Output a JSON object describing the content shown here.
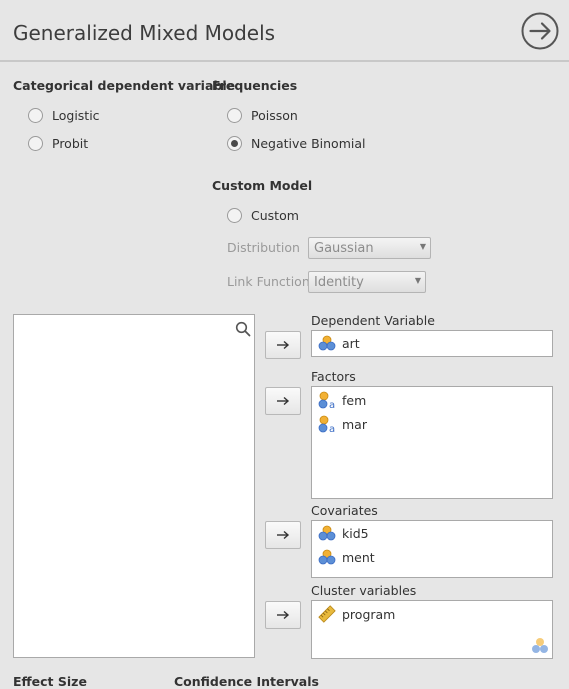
{
  "header": {
    "title": "Generalized Mixed Models",
    "go_icon": "arrow-circle-right-icon"
  },
  "categorical": {
    "title": "Categorical dependent variable",
    "options": [
      {
        "label": "Logistic",
        "selected": false
      },
      {
        "label": "Probit",
        "selected": false
      }
    ]
  },
  "frequencies": {
    "title": "Frequencies",
    "options": [
      {
        "label": "Poisson",
        "selected": false
      },
      {
        "label": "Negative Binomial",
        "selected": true
      }
    ]
  },
  "custom_model": {
    "title": "Custom Model",
    "custom_label": "Custom",
    "custom_selected": false,
    "distribution_label": "Distribution",
    "distribution_value": "Gaussian",
    "link_label": "Link Function",
    "link_value": "Identity"
  },
  "variables": {
    "search_icon": "search-icon",
    "dependent": {
      "label": "Dependent Variable",
      "items": [
        "art"
      ]
    },
    "factors": {
      "label": "Factors",
      "items": [
        "fem",
        "mar"
      ]
    },
    "covariates": {
      "label": "Covariates",
      "items": [
        "kid5",
        "ment"
      ]
    },
    "cluster": {
      "label": "Cluster variables",
      "items": [
        "program"
      ]
    }
  },
  "bottom": {
    "effect_size": "Effect Size",
    "confidence_intervals": "Confidence Intervals"
  },
  "colors": {
    "ordinal_orange": "#f2b134",
    "nominal_blue": "#5c8fd6",
    "nominal_text": "#3b6cc4",
    "id_ruler": "#e8b93c"
  }
}
